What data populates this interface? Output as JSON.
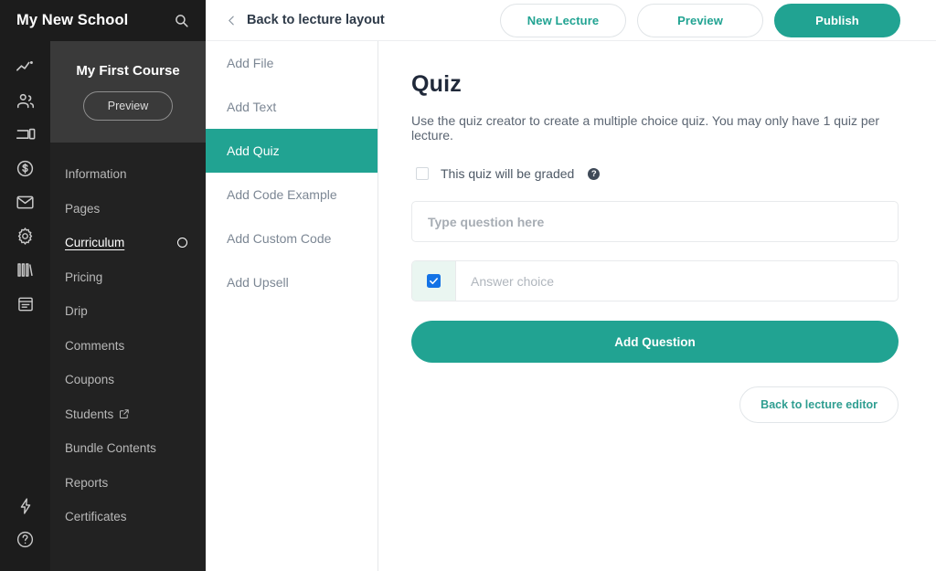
{
  "brand": {
    "title": "My New School",
    "search_icon": "search-icon"
  },
  "course": {
    "title": "My First Course",
    "preview_label": "Preview"
  },
  "sidebar": {
    "rail_icons": [
      {
        "name": "analytics-icon"
      },
      {
        "name": "users-icon"
      },
      {
        "name": "devices-icon"
      },
      {
        "name": "money-icon"
      },
      {
        "name": "email-icon"
      },
      {
        "name": "settings-gear-icon"
      },
      {
        "name": "library-books-icon"
      },
      {
        "name": "clipboard-icon"
      }
    ],
    "rail_bottom_icons": [
      {
        "name": "lightning-bolt-icon"
      },
      {
        "name": "help-circle-icon"
      }
    ],
    "items": [
      {
        "label": "Information",
        "active": false,
        "external": false,
        "indicator": false
      },
      {
        "label": "Pages",
        "active": false,
        "external": false,
        "indicator": false
      },
      {
        "label": "Curriculum",
        "active": true,
        "external": false,
        "indicator": true
      },
      {
        "label": "Pricing",
        "active": false,
        "external": false,
        "indicator": false
      },
      {
        "label": "Drip",
        "active": false,
        "external": false,
        "indicator": false
      },
      {
        "label": "Comments",
        "active": false,
        "external": false,
        "indicator": false
      },
      {
        "label": "Coupons",
        "active": false,
        "external": false,
        "indicator": false
      },
      {
        "label": "Students",
        "active": false,
        "external": true,
        "indicator": false
      },
      {
        "label": "Bundle Contents",
        "active": false,
        "external": false,
        "indicator": false
      },
      {
        "label": "Reports",
        "active": false,
        "external": false,
        "indicator": false
      },
      {
        "label": "Certificates",
        "active": false,
        "external": false,
        "indicator": false
      }
    ]
  },
  "midcol": {
    "items": [
      {
        "label": "Add File",
        "active": false
      },
      {
        "label": "Add Text",
        "active": false
      },
      {
        "label": "Add Quiz",
        "active": true
      },
      {
        "label": "Add Code Example",
        "active": false
      },
      {
        "label": "Add Custom Code",
        "active": false
      },
      {
        "label": "Add Upsell",
        "active": false
      }
    ]
  },
  "topbar": {
    "back_label": "Back to lecture layout",
    "back_icon": "chevron-left-icon",
    "new_lecture_label": "New Lecture",
    "preview_label": "Preview",
    "publish_label": "Publish"
  },
  "main": {
    "title": "Quiz",
    "description": "Use the quiz creator to create a multiple choice quiz. You may only have 1 quiz per lecture.",
    "graded_label": "This quiz will be graded",
    "graded_checked": false,
    "help_icon": "help-circle-icon",
    "question_placeholder": "Type question here",
    "question_value": "",
    "answer_placeholder": "Answer choice",
    "answer_value": "",
    "answer_checked": true,
    "add_question_label": "Add Question",
    "back_to_editor_label": "Back to lecture editor"
  },
  "colors": {
    "accent_teal": "#21a392",
    "checkbox_blue": "#1473e6",
    "sidebar_dark": "#222222",
    "rail_dark": "#1c1c1c",
    "course_panel": "#3a3a3a",
    "answer_cell_bg": "#eaf6f1"
  }
}
